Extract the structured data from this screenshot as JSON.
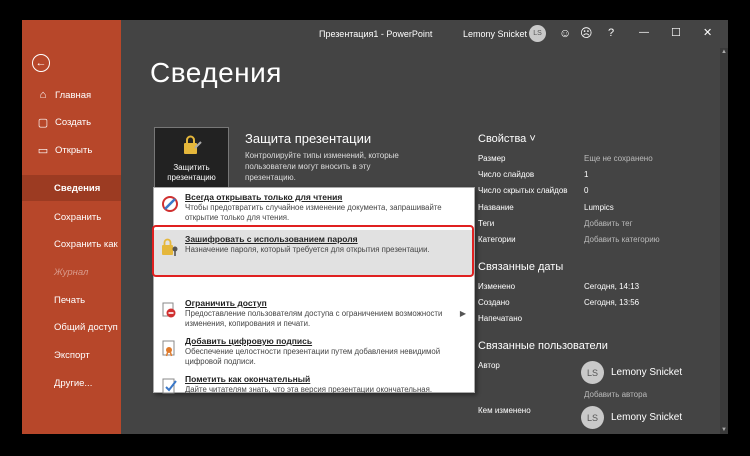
{
  "titlebar": {
    "doc_title": "Презентация1  -  PowerPoint",
    "user_name": "Lemony Snicket",
    "user_initials": "LS",
    "icons": [
      "smile-icon",
      "frown-icon",
      "help-icon",
      "minimize-icon",
      "maximize-icon",
      "close-icon"
    ],
    "smile": "☺",
    "frown": "☹",
    "help": "?",
    "minimize": "—",
    "maximize": "☐",
    "close": "✕"
  },
  "sidebar": {
    "back": "←",
    "items": [
      {
        "label": "Главная",
        "icon": "⌂"
      },
      {
        "label": "Создать",
        "icon": "▢"
      },
      {
        "label": "Открыть",
        "icon": "▭"
      },
      {
        "label": "Сведения"
      },
      {
        "label": "Сохранить"
      },
      {
        "label": "Сохранить как"
      },
      {
        "label": "Журнал"
      },
      {
        "label": "Печать"
      },
      {
        "label": "Общий доступ"
      },
      {
        "label": "Экспорт"
      },
      {
        "label": "Другие..."
      }
    ]
  },
  "page_title": "Сведения",
  "protect": {
    "button_label_1": "Защитить",
    "button_label_2": "презентацию",
    "title": "Защита презентации",
    "description": "Контролируйте типы изменений, которые пользователи могут вносить в эту презентацию."
  },
  "menu": [
    {
      "title": "Всегда открывать только для чтения",
      "desc": "Чтобы предотвратить случайное изменение документа, запрашивайте открытие только для чтения."
    },
    {
      "title": "Зашифровать с использованием пароля",
      "desc": "Назначение пароля, который требуется для открытия презентации."
    },
    {
      "title": "Ограничить доступ",
      "desc": "Предоставление пользователям доступа с ограничением возможности изменения, копирования и печати."
    },
    {
      "title": "Добавить цифровую подпись",
      "desc": "Обеспечение целостности презентации путем добавления невидимой цифровой подписи."
    },
    {
      "title": "Пометить как окончательный",
      "desc": "Дайте читателям знать, что эта версия презентации окончательная."
    }
  ],
  "properties": {
    "heading": "Свойства ˅",
    "rows": [
      {
        "label": "Размер",
        "value": "Еще не сохранено"
      },
      {
        "label": "Число слайдов",
        "value": "1"
      },
      {
        "label": "Число скрытых слайдов",
        "value": "0"
      },
      {
        "label": "Название",
        "value": "Lumpics"
      },
      {
        "label": "Теги",
        "value": "Добавить тег"
      },
      {
        "label": "Категории",
        "value": "Добавить категорию"
      }
    ]
  },
  "dates": {
    "heading": "Связанные даты",
    "rows": [
      {
        "label": "Изменено",
        "value": "Сегодня, 14:13"
      },
      {
        "label": "Создано",
        "value": "Сегодня, 13:56"
      },
      {
        "label": "Напечатано",
        "value": ""
      }
    ]
  },
  "people": {
    "heading": "Связанные пользователи",
    "author_label": "Автор",
    "author_initials": "LS",
    "author_name": "Lemony Snicket",
    "add_author": "Добавить автора",
    "modified_label": "Кем изменено",
    "modifier_initials": "LS",
    "modifier_name": "Lemony Snicket"
  },
  "colors": {
    "sidebar": "#b7472a",
    "sidebar_active": "#9c3b22",
    "background": "#444444",
    "highlight_outline": "#e02020"
  }
}
